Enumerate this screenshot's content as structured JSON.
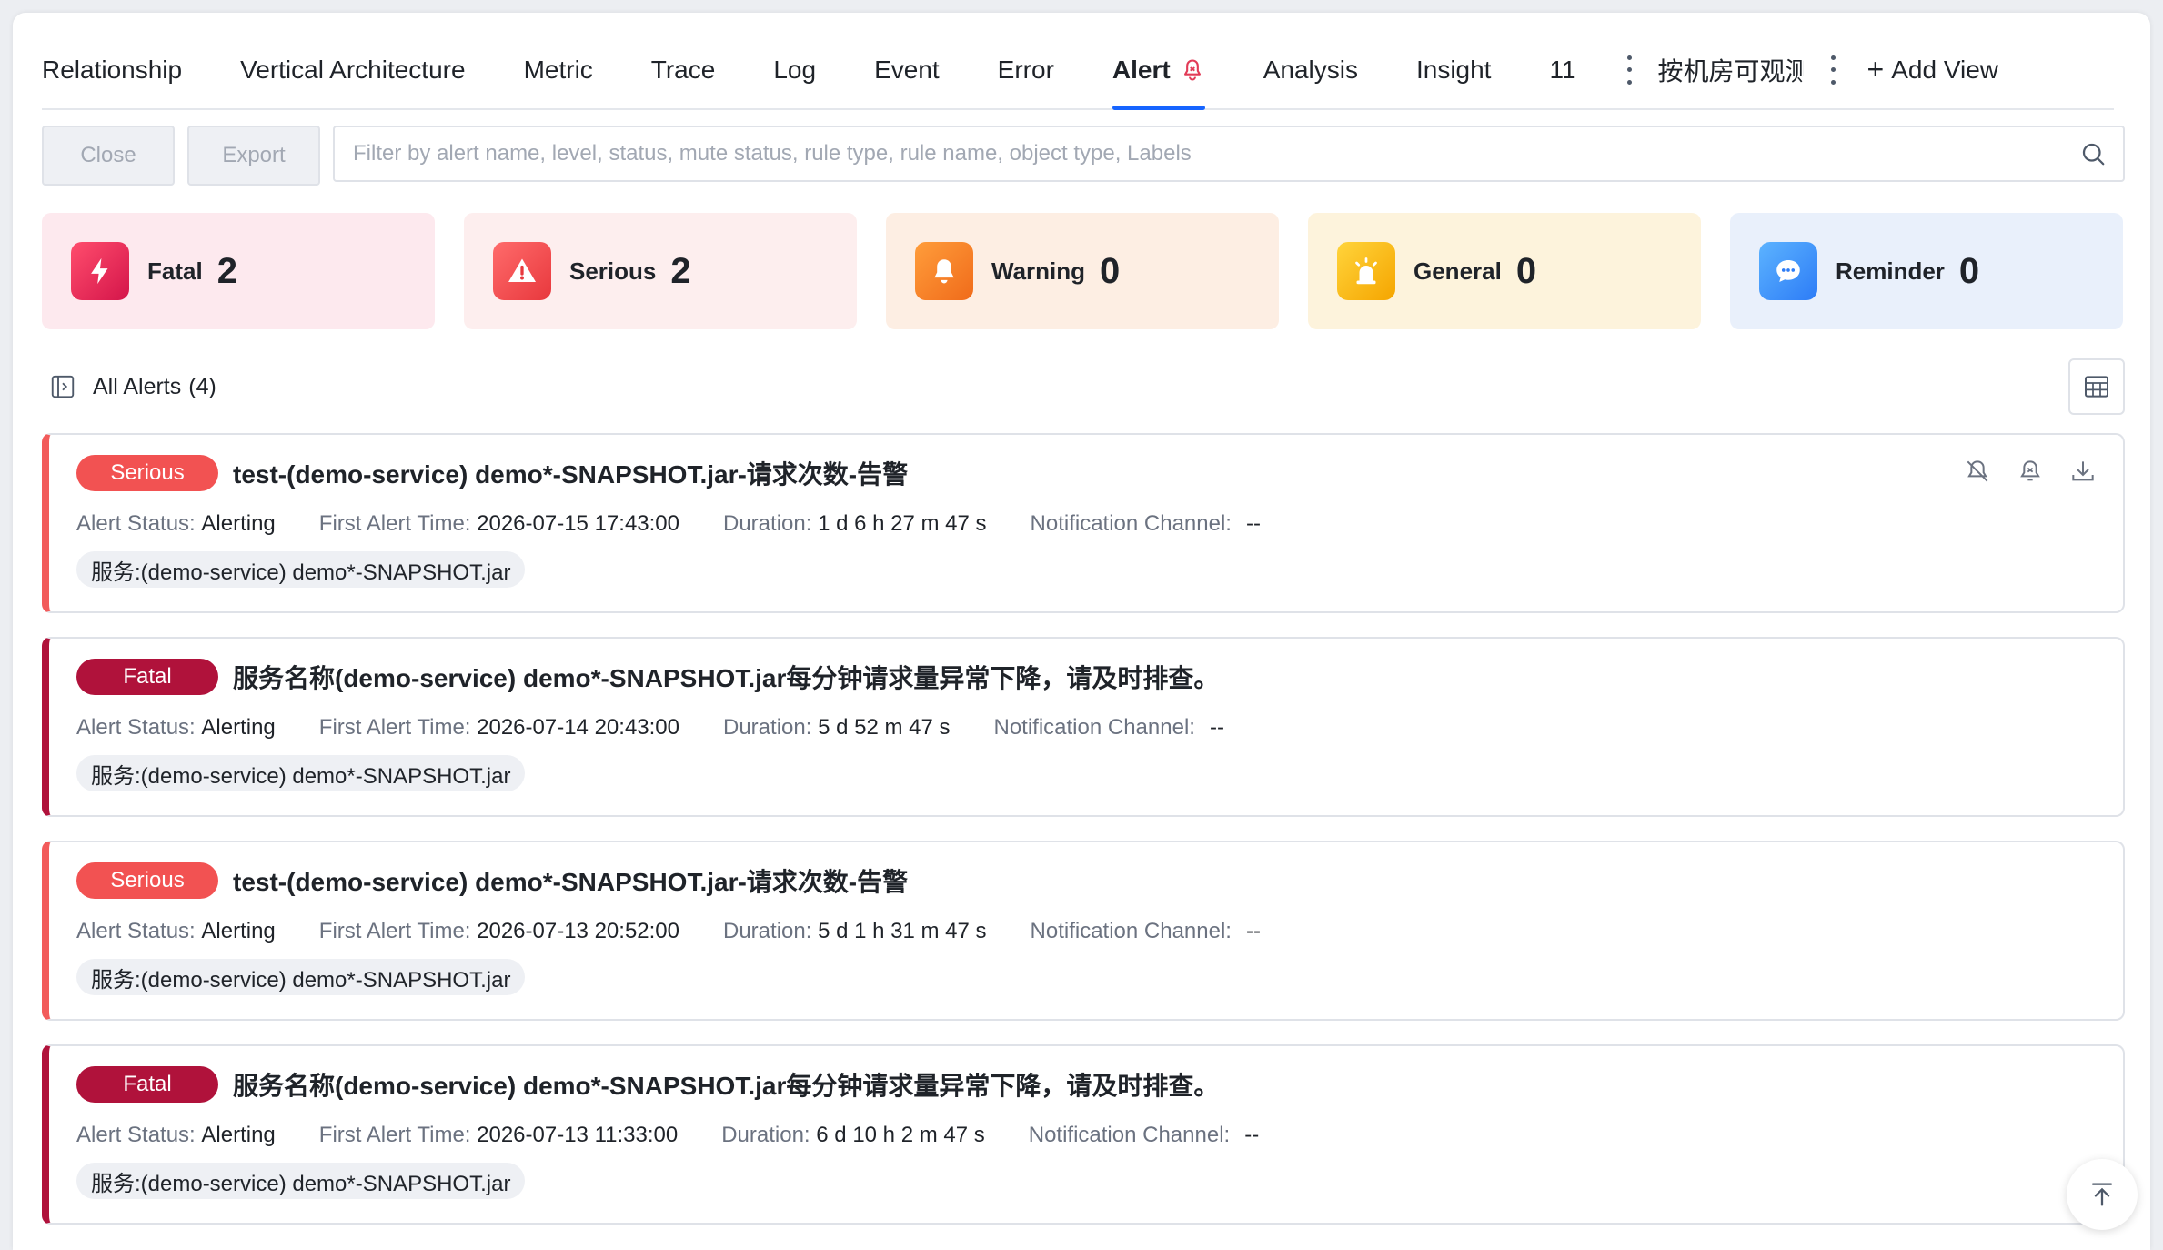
{
  "tabs": [
    {
      "label": "Relationship"
    },
    {
      "label": "Vertical Architecture"
    },
    {
      "label": "Metric"
    },
    {
      "label": "Trace"
    },
    {
      "label": "Log"
    },
    {
      "label": "Event"
    },
    {
      "label": "Error"
    },
    {
      "label": "Alert",
      "active": true
    },
    {
      "label": "Analysis"
    },
    {
      "label": "Insight"
    }
  ],
  "hidden_tab_count": "11",
  "custom_tab_label": "按机房可观测",
  "add_view_label": "Add View",
  "toolbar": {
    "close_label": "Close",
    "export_label": "Export",
    "search_placeholder": "Filter by alert name, level, status, mute status, rule type, rule name, object type, Labels"
  },
  "summary": [
    {
      "label": "Fatal",
      "count": "2",
      "bg": "#fde9ee",
      "icon": "lightning-icon"
    },
    {
      "label": "Serious",
      "count": "2",
      "bg": "#fdeeee",
      "icon": "warning-triangle-icon"
    },
    {
      "label": "Warning",
      "count": "0",
      "bg": "#fdeee3",
      "icon": "bell-icon"
    },
    {
      "label": "General",
      "count": "0",
      "bg": "#fdf3dc",
      "icon": "alarm-light-icon"
    },
    {
      "label": "Reminder",
      "count": "0",
      "bg": "#e9f0fb",
      "icon": "chat-bubble-icon"
    }
  ],
  "list": {
    "title": "All Alerts",
    "count": "(4)"
  },
  "field_labels": {
    "status": "Alert Status:",
    "first_time": "First Alert Time:",
    "duration": "Duration:",
    "channel": "Notification Channel:"
  },
  "alerts": [
    {
      "level": "Serious",
      "title": "test-(demo-service) demo*-SNAPSHOT.jar-请求次数-告警",
      "status": "Alerting",
      "first_time": "2026-07-15 17:43:00",
      "duration": "1 d 6 h 27 m 47 s",
      "channel": "--",
      "tag": "服务:(demo-service) demo*-SNAPSHOT.jar"
    },
    {
      "level": "Fatal",
      "title": "服务名称(demo-service) demo*-SNAPSHOT.jar每分钟请求量异常下降，请及时排查。",
      "status": "Alerting",
      "first_time": "2026-07-14 20:43:00",
      "duration": "5 d 52 m 47 s",
      "channel": "--",
      "tag": "服务:(demo-service) demo*-SNAPSHOT.jar"
    },
    {
      "level": "Serious",
      "title": "test-(demo-service) demo*-SNAPSHOT.jar-请求次数-告警",
      "status": "Alerting",
      "first_time": "2026-07-13 20:52:00",
      "duration": "5 d 1 h 31 m 47 s",
      "channel": "--",
      "tag": "服务:(demo-service) demo*-SNAPSHOT.jar"
    },
    {
      "level": "Fatal",
      "title": "服务名称(demo-service) demo*-SNAPSHOT.jar每分钟请求量异常下降，请及时排查。",
      "status": "Alerting",
      "first_time": "2026-07-13 11:33:00",
      "duration": "6 d 10 h 2 m 47 s",
      "channel": "--",
      "tag": "服务:(demo-service) demo*-SNAPSHOT.jar"
    }
  ],
  "colors": {
    "accent": "#1664ff",
    "serious": "#f25252",
    "fatal": "#b0123b"
  }
}
